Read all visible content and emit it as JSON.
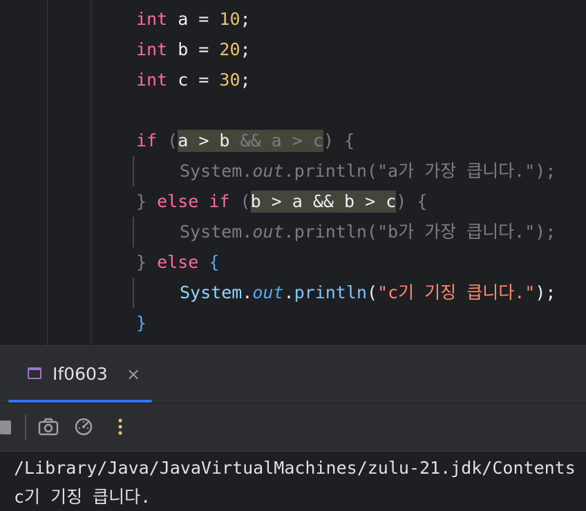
{
  "editor": {
    "lines": [
      {
        "parts": [
          {
            "t": "int",
            "c": "kw2"
          },
          {
            "t": " a = ",
            "c": "ident"
          },
          {
            "t": "10",
            "c": "num2"
          },
          {
            "t": ";",
            "c": "ident"
          }
        ]
      },
      {
        "parts": [
          {
            "t": "int",
            "c": "kw2"
          },
          {
            "t": " b = ",
            "c": "ident"
          },
          {
            "t": "20",
            "c": "num2"
          },
          {
            "t": ";",
            "c": "ident"
          }
        ]
      },
      {
        "parts": [
          {
            "t": "int",
            "c": "kw2"
          },
          {
            "t": " c = ",
            "c": "ident"
          },
          {
            "t": "30",
            "c": "num2"
          },
          {
            "t": ";",
            "c": "ident"
          }
        ]
      },
      {
        "parts": []
      },
      {
        "parts": [
          {
            "t": "if",
            "c": "kw2"
          },
          {
            "t": " (",
            "c": "dim"
          },
          {
            "t": "a > b ",
            "c": "ident hl"
          },
          {
            "t": "&& a > c",
            "c": "dim hl"
          },
          {
            "t": ")",
            "c": "dim"
          },
          {
            "t": " {",
            "c": "dim"
          }
        ]
      },
      {
        "indent": true,
        "parts": [
          {
            "t": "System.",
            "c": "dim"
          },
          {
            "t": "out",
            "c": "dim field-it"
          },
          {
            "t": ".println(\"a가 가장 큽니다.\");",
            "c": "dim"
          }
        ]
      },
      {
        "parts": [
          {
            "t": "} ",
            "c": "dim"
          },
          {
            "t": "else if",
            "c": "kw2"
          },
          {
            "t": " (",
            "c": "dim"
          },
          {
            "t": "b > a && b > c",
            "c": "ident hl"
          },
          {
            "t": ")",
            "c": "dim"
          },
          {
            "t": " {",
            "c": "dim"
          }
        ]
      },
      {
        "indent": true,
        "parts": [
          {
            "t": "System.",
            "c": "dim"
          },
          {
            "t": "out",
            "c": "dim field-it"
          },
          {
            "t": ".println(\"b가 가장 큽니다.\");",
            "c": "dim"
          }
        ]
      },
      {
        "parts": [
          {
            "t": "} ",
            "c": "dim"
          },
          {
            "t": "else",
            "c": "kw2"
          },
          {
            "t": " {",
            "c": "brace-hl"
          }
        ]
      },
      {
        "indent": true,
        "parts": [
          {
            "t": "System",
            "c": "cls"
          },
          {
            "t": ".",
            "c": "ident"
          },
          {
            "t": "out",
            "c": "fieldb"
          },
          {
            "t": ".",
            "c": "ident"
          },
          {
            "t": "println",
            "c": "meth2"
          },
          {
            "t": "(",
            "c": "ident"
          },
          {
            "t": "\"c기 기징 큽니다.\"",
            "c": "str2"
          },
          {
            "t": ");",
            "c": "ident"
          }
        ]
      },
      {
        "parts": [
          {
            "t": "}",
            "c": "brace-hl"
          }
        ]
      }
    ]
  },
  "run_panel": {
    "tab_label": "If0603",
    "close_glyph": "×",
    "toolbar": {
      "stop": "stop-icon",
      "screenshot": "camera-icon",
      "profiler": "gauge-icon",
      "more": "more-vertical-icon"
    }
  },
  "console": {
    "lines": [
      "/Library/Java/JavaVirtualMachines/zulu-21.jdk/Contents",
      "c기 기징 큽니다."
    ]
  },
  "colors": {
    "background": "#1e1f22",
    "keyword": "#ff6b9a",
    "number": "#e8c46a",
    "string": "#ff8a6e",
    "accent": "#3574f0",
    "selection_highlight": "#45453a",
    "more_icon": "#e9c46a"
  }
}
